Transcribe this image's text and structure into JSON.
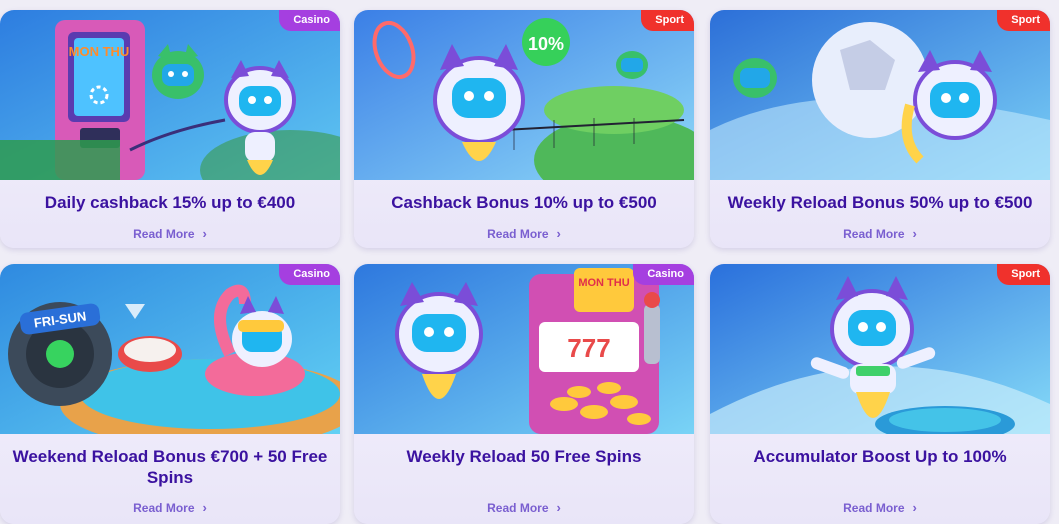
{
  "promotions": [
    {
      "title": "Daily cashback 15% up to €400",
      "tag": "Casino",
      "link": "Read More",
      "art_text": "MON THU"
    },
    {
      "title": "Cashback Bonus 10% up to €500",
      "tag": "Sport",
      "link": "Read More",
      "art_text": "10%"
    },
    {
      "title": "Weekly Reload Bonus 50% up to €500",
      "tag": "Sport",
      "link": "Read More"
    },
    {
      "title": "Weekend Reload Bonus €700 + 50 Free Spins",
      "tag": "Casino",
      "link": "Read More",
      "art_text": "FRI-SUN"
    },
    {
      "title": "Weekly Reload 50 Free Spins",
      "tag": "Casino",
      "link": "Read More",
      "art_text": "MON THU",
      "art_text_2": "777"
    },
    {
      "title": "Accumulator Boost Up to 100%",
      "tag": "Sport",
      "link": "Read More"
    }
  ],
  "colors": {
    "casino_tag": "#a53fe0",
    "sport_tag": "#f0312c",
    "title": "#3b12a0",
    "link": "#7a5fd0"
  },
  "icons": {
    "link_arrow": "chevron-right-icon"
  }
}
